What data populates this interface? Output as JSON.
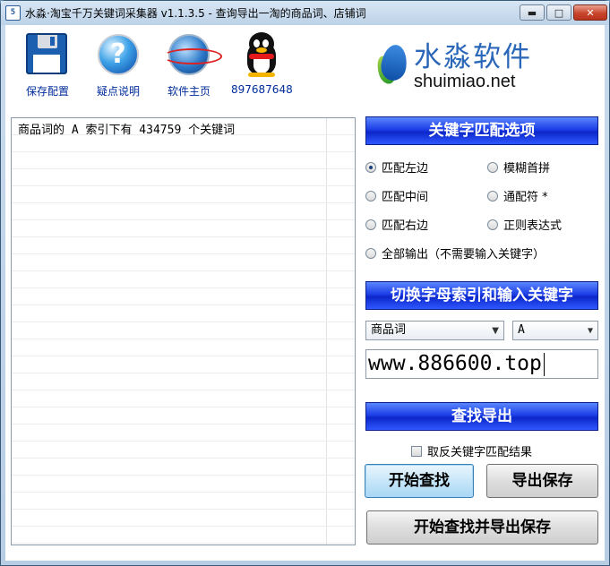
{
  "window": {
    "icon_text": "5",
    "title": "水淼·淘宝千万关键词采集器 v1.1.3.5 - 查询导出一淘的商品词、店铺词",
    "controls": {
      "minimize": "▬",
      "maximize": "□",
      "close": "✕"
    }
  },
  "toolbar": {
    "items": [
      {
        "label": "保存配置",
        "icon": "floppy-disk"
      },
      {
        "label": "疑点说明",
        "icon": "help"
      },
      {
        "label": "软件主页",
        "icon": "globe"
      },
      {
        "label": "897687648",
        "icon": "qq-penguin"
      }
    ]
  },
  "brand": {
    "name": "水淼软件",
    "url": "shuimiao.net"
  },
  "results": {
    "rows": [
      "商品词的 A 索引下有 434759 个关键词"
    ]
  },
  "match_options": {
    "header": "关键字匹配选项",
    "options": [
      {
        "label": "匹配左边",
        "checked": true
      },
      {
        "label": "模糊首拼",
        "checked": false
      },
      {
        "label": "匹配中间",
        "checked": false
      },
      {
        "label": "通配符 *",
        "checked": false
      },
      {
        "label": "匹配右边",
        "checked": false
      },
      {
        "label": "正则表达式",
        "checked": false
      },
      {
        "label": "全部输出（不需要输入关键字）",
        "checked": false
      }
    ]
  },
  "index_switch": {
    "header": "切换字母索引和输入关键字",
    "type_select": "商品词",
    "letter_select": "A",
    "keyword_value": "www.886600.top"
  },
  "search_export": {
    "header": "查找导出",
    "invert_checkbox": "取反关键字匹配结果",
    "start_search": "开始查找",
    "export_save": "导出保存",
    "search_and_export": "开始查找并导出保存"
  }
}
